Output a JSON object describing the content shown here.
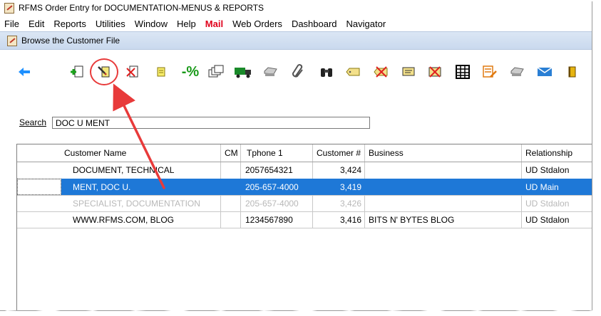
{
  "window": {
    "title": "RFMS Order Entry for DOCUMENTATION-MENUS & REPORTS"
  },
  "menu": [
    "File",
    "Edit",
    "Reports",
    "Utilities",
    "Window",
    "Help",
    "Mail",
    "Web Orders",
    "Dashboard",
    "Navigator"
  ],
  "form": {
    "title": "Browse the Customer File"
  },
  "toolbar": {
    "pct_label": "-%",
    "icons": [
      "back-arrow-icon",
      "add-record-icon",
      "edit-record-icon",
      "delete-record-icon",
      "note-icon",
      "percent-icon",
      "copy-icon",
      "truck-icon",
      "printer-icon",
      "paperclip-icon",
      "binoculars-icon",
      "tag-icon",
      "cancel-tag-icon",
      "ticket-icon",
      "delete-ticket-icon",
      "grid-icon",
      "edit-list-icon",
      "printer2-icon",
      "email-icon",
      "book-icon"
    ]
  },
  "search": {
    "label": "Search",
    "value": "DOC U MENT"
  },
  "grid": {
    "headers": [
      "Customer Name",
      "CM",
      "Tphone 1",
      "Customer #",
      "Business",
      "Relationship"
    ],
    "rows": [
      {
        "name": "DOCUMENT, TECHNICAL",
        "cm": "",
        "phone": "2057654321",
        "number": "3,424",
        "business": "",
        "relationship": "UD Stdalon"
      },
      {
        "name": "MENT, DOC U.",
        "cm": "",
        "phone": "205-657-4000",
        "number": "3,419",
        "business": "",
        "relationship": "UD Main"
      },
      {
        "name": "SPECIALIST, DOCUMENTATION",
        "cm": "",
        "phone": "205-657-4000",
        "number": "3,426",
        "business": "",
        "relationship": "UD Stdalon"
      },
      {
        "name": "WWW.RFMS.COM, BLOG",
        "cm": "",
        "phone": "1234567890",
        "number": "3,416",
        "business": "BITS N' BYTES BLOG",
        "relationship": "UD Stdalon"
      }
    ]
  },
  "colors": {
    "selection": "#1e78d7",
    "accent_red": "#e83a3a",
    "mail_red": "#e0001b",
    "back_arrow": "#1e90ff"
  }
}
